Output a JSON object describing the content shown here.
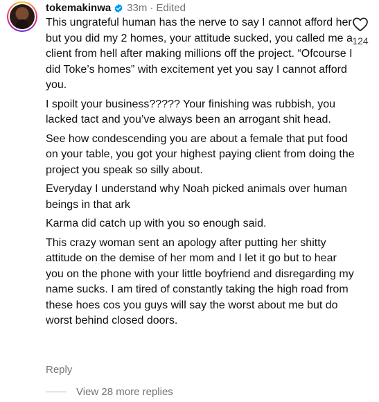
{
  "comment": {
    "username": "tokemakinwa",
    "verified": true,
    "time": "33m",
    "separator": "·",
    "edited": "Edited",
    "paragraphs": [
      "This ungrateful human has the nerve to say I cannot afford her but you did my 2 homes, your attitude sucked, you called me a client from hell after making millions off the project. “Ofcourse I did Toke’s homes” with excitement yet you say I cannot afford you.",
      "I spoilt your business????? Your finishing was rubbish, you lacked tact and you’ve always been an arrogant shit head.",
      "See how condescending you are about a female that put food on your table, you got your highest paying client from doing the project you speak so silly about.",
      "Everyday I understand why Noah picked animals over human beings in that ark",
      "Karma did catch up with you so enough said.",
      "This crazy woman sent an apology after putting her shitty attitude on the demise of her mom and I let it go but to hear you on the phone with your little boyfriend and disregarding my name sucks. I am tired of constantly taking the high road from these hoes cos you guys will say the worst about me but do worst behind closed doors."
    ],
    "reply_label": "Reply",
    "view_replies_label": "View 28 more replies",
    "like_count": "124",
    "like_icon": "heart-outline-icon",
    "verified_color": "#0095f6"
  }
}
